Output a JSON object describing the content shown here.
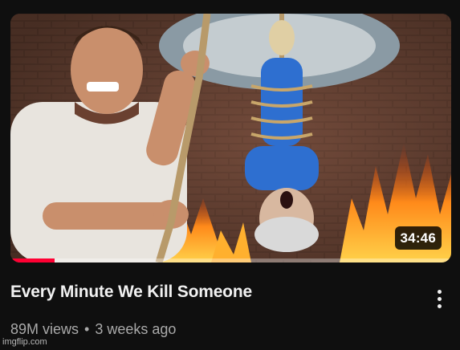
{
  "video": {
    "title": "Every Minute We Kill Someone",
    "views": "89M views",
    "separator": "•",
    "age": "3 weeks ago",
    "duration": "34:46",
    "watch_progress": 0.1
  },
  "thumbnail": {
    "icon": "video-thumbnail-image",
    "colors": {
      "wall": "#5a3a2c",
      "fire": "#ff8a1a",
      "shirt": "#e8e4de",
      "rope": "#b89a6a",
      "outfit": "#2e6fd0"
    }
  },
  "menu": {
    "icon": "more-vertical-icon"
  },
  "watermark": "imgflip.com",
  "theme": {
    "background": "#0f0f0f",
    "progress_color": "#ff0033",
    "meta_color": "#aaaaaa"
  }
}
